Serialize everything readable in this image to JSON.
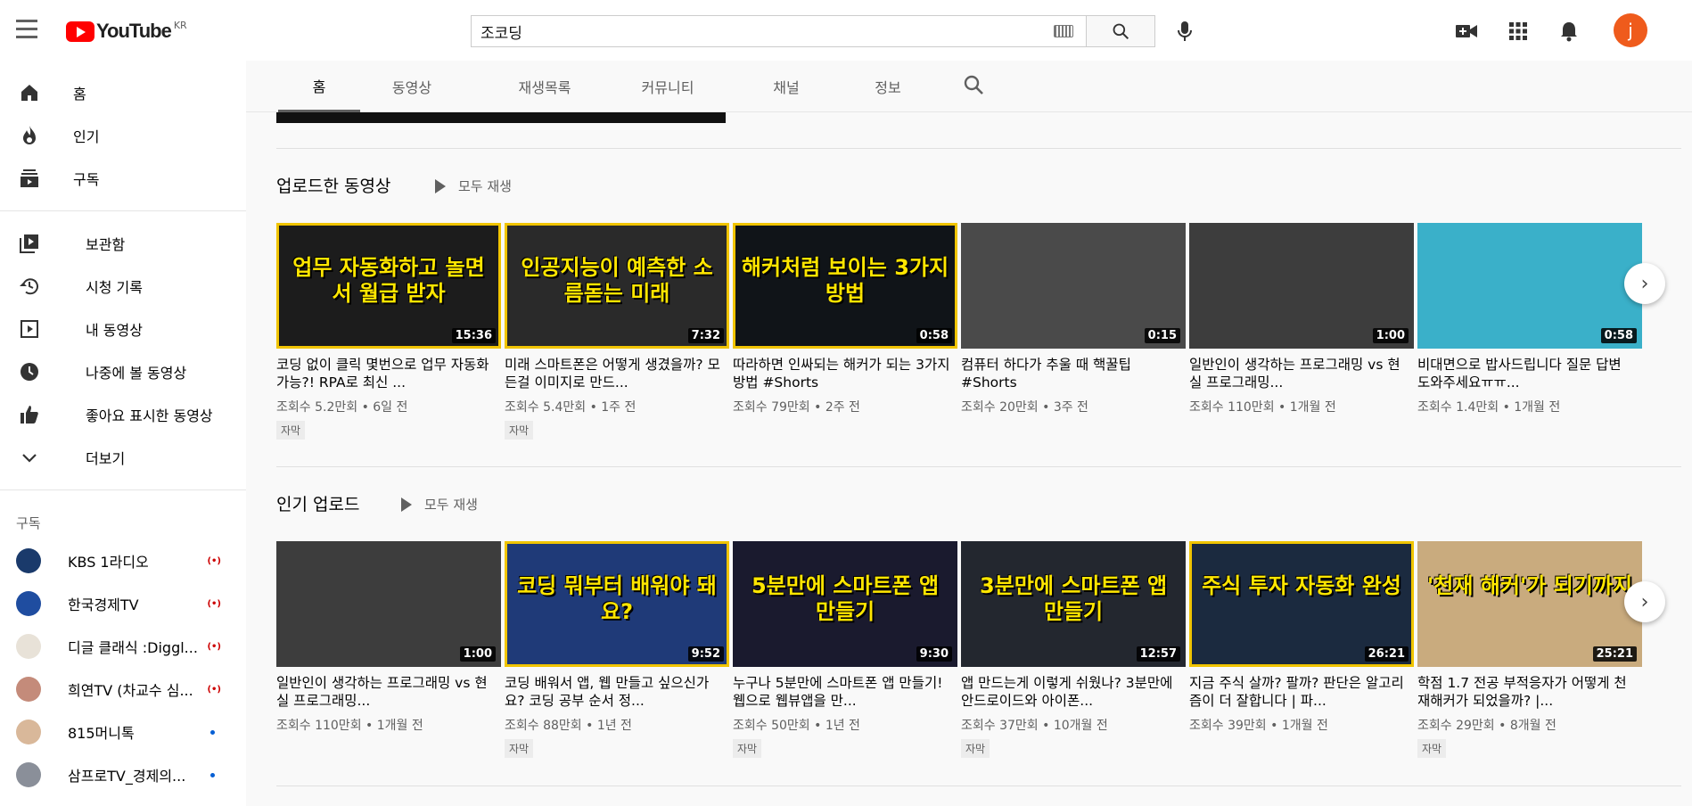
{
  "header": {
    "logo_text": "YouTube",
    "logo_region": "KR",
    "search_value": "조코딩"
  },
  "sidebar": {
    "main": [
      {
        "label": "홈",
        "icon": "home-icon"
      },
      {
        "label": "인기",
        "icon": "trending-icon"
      },
      {
        "label": "구독",
        "icon": "subscriptions-icon"
      }
    ],
    "library": [
      {
        "label": "보관함",
        "icon": "library-icon"
      },
      {
        "label": "시청 기록",
        "icon": "history-icon"
      },
      {
        "label": "내 동영상",
        "icon": "your-videos-icon"
      },
      {
        "label": "나중에 볼 동영상",
        "icon": "watch-later-icon"
      },
      {
        "label": "좋아요 표시한 동영상",
        "icon": "liked-icon"
      },
      {
        "label": "더보기",
        "icon": "chevron-down-icon"
      }
    ],
    "subscriptions_heading": "구독",
    "subscriptions": [
      {
        "label": "KBS 1라디오",
        "status": "live",
        "color": "#1a3a6b"
      },
      {
        "label": "한국경제TV",
        "status": "live",
        "color": "#1f4da0"
      },
      {
        "label": "디글 클래식 :Diggl...",
        "status": "live",
        "color": "#e8e2d8"
      },
      {
        "label": "희연TV (차교수 심...",
        "status": "live",
        "color": "#c48b7a"
      },
      {
        "label": "815머니톡",
        "status": "new",
        "color": "#d9b89a"
      },
      {
        "label": "삼프로TV_경제의...",
        "status": "new",
        "color": "#8a8f99"
      }
    ]
  },
  "channel_tabs": [
    "홈",
    "동영상",
    "재생목록",
    "커뮤니티",
    "채널",
    "정보"
  ],
  "shelves": [
    {
      "title": "업로드한 동영상",
      "play_all": "모두 재생",
      "videos": [
        {
          "title": "코딩 없이 클릭 몇번으로 업무 자동화 가능?! RPA로 최신 ...",
          "meta": "조회수 5.2만회 • 6일 전",
          "duration": "15:36",
          "badge": "자막",
          "thumb_text": "업무 자동화하고 놀면서 월급 받자",
          "bg": "#1c1c1c",
          "border": "#f0c400"
        },
        {
          "title": "미래 스마트폰은 어떻게 생겼을까? 모든걸 이미지로 만드...",
          "meta": "조회수 5.4만회 • 1주 전",
          "duration": "7:32",
          "badge": "자막",
          "thumb_text": "인공지능이 예측한 소름돋는 미래",
          "bg": "#2a2a2a",
          "border": "#f0c400"
        },
        {
          "title": "따라하면 인싸되는 해커가 되는 3가지 방법 #Shorts",
          "meta": "조회수 79만회 • 2주 전",
          "duration": "0:58",
          "badge": "",
          "thumb_text": "해커처럼 보이는 3가지 방법",
          "bg": "#101418",
          "border": "#f0c400"
        },
        {
          "title": "컴퓨터 하다가 추울 때 핵꿀팁 #Shorts",
          "meta": "조회수 20만회 • 3주 전",
          "duration": "0:15",
          "badge": "",
          "thumb_text": "",
          "bg": "#4a4a4a",
          "border": ""
        },
        {
          "title": "일반인이 생각하는 프로그래밍 vs 현실 프로그래밍...",
          "meta": "조회수 110만회 • 1개월 전",
          "duration": "1:00",
          "badge": "",
          "thumb_text": "",
          "bg": "#3d3d3d",
          "border": ""
        },
        {
          "title": "비대면으로 밥사드립니다 질문 답변 도와주세요ㅠㅠ...",
          "meta": "조회수 1.4만회 • 1개월 전",
          "duration": "0:58",
          "badge": "",
          "thumb_text": "",
          "bg": "#3ab0c9",
          "border": ""
        }
      ]
    },
    {
      "title": "인기 업로드",
      "play_all": "모두 재생",
      "videos": [
        {
          "title": "일반인이 생각하는 프로그래밍 vs 현실 프로그래밍...",
          "meta": "조회수 110만회 • 1개월 전",
          "duration": "1:00",
          "badge": "",
          "thumb_text": "",
          "bg": "#3d3d3d",
          "border": ""
        },
        {
          "title": "코딩 배워서 앱, 웹 만들고 싶으신가요? 코딩 공부 순서 정...",
          "meta": "조회수 88만회 • 1년 전",
          "duration": "9:52",
          "badge": "자막",
          "thumb_text": "코딩 뭐부터 배워야 돼요?",
          "bg": "#1f3a78",
          "border": "#f0c400"
        },
        {
          "title": "누구나 5분만에 스마트폰 앱 만들기! 웹으로 웹뷰앱을 만...",
          "meta": "조회수 50만회 • 1년 전",
          "duration": "9:30",
          "badge": "자막",
          "thumb_text": "5분만에 스마트폰 앱 만들기",
          "bg": "#1a1a2e",
          "border": ""
        },
        {
          "title": "앱 만드는게 이렇게 쉬웠나? 3분만에 안드로이드와 아이폰...",
          "meta": "조회수 37만회 • 10개월 전",
          "duration": "12:57",
          "badge": "자막",
          "thumb_text": "3분만에 스마트폰 앱 만들기",
          "bg": "#23272f",
          "border": ""
        },
        {
          "title": "지금 주식 살까? 팔까? 판단은 알고리즘이 더 잘합니다 | 파...",
          "meta": "조회수 39만회 • 1개월 전",
          "duration": "26:21",
          "badge": "",
          "thumb_text": "주식 투자 자동화 완성",
          "bg": "#1b2a3f",
          "border": "#f0c400"
        },
        {
          "title": "학점 1.7 전공 부적응자가 어떻게 천재해커가 되었을까? |...",
          "meta": "조회수 29만회 • 8개월 전",
          "duration": "25:21",
          "badge": "자막",
          "thumb_text": "'천재 해커'가 되기까지",
          "bg": "#c9ab7e",
          "border": ""
        }
      ]
    }
  ]
}
